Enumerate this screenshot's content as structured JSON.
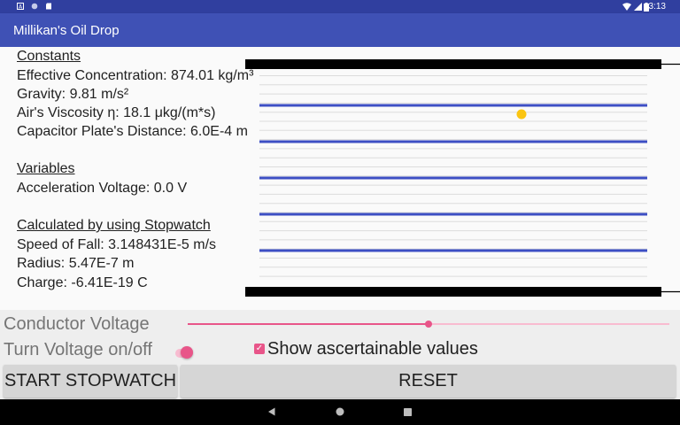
{
  "status_bar": {
    "time": "3:13",
    "icons_left": [
      "a-icon",
      "circle-icon",
      "sd-icon"
    ],
    "icons_right": [
      "wifi-icon",
      "signal-icon",
      "battery-icon"
    ]
  },
  "app_bar": {
    "title": "Millikan's Oil Drop"
  },
  "constants": {
    "header": "Constants",
    "concentration": "Effective Concentration:  874.01 kg/m³",
    "gravity": "Gravity:  9.81 m/s²",
    "viscosity": "Air's Viscosity η:  18.1 μkg/(m*s)",
    "distance": "Capacitor Plate's Distance:  6.0E-4 m"
  },
  "variables": {
    "header": "Variables",
    "voltage": "Acceleration Voltage:  0.0 V"
  },
  "stopwatch_calc": {
    "header": "Calculated by using Stopwatch",
    "speed": "Speed of Fall:  3.148431E-5 m/s",
    "radius": "Radius:  5.47E-7 m",
    "charge": "Charge:  -6.41E-19 C"
  },
  "simulation": {
    "plate_color": "#000000",
    "marker_line_color": "#3d4fc4",
    "grid_line_color": "#dcdcdc",
    "drop_color": "#fbc512"
  },
  "controls": {
    "conductor_label": "Conductor Voltage",
    "conductor_value": 0.5,
    "toggle_label": "Turn Voltage on/off",
    "toggle_on": true,
    "checkbox_label": "Show ascertainable values",
    "checkbox_checked": true,
    "stopwatch_button": "START STOPWATCH",
    "reset_button": "RESET",
    "accent_color": "#e85589"
  },
  "nav_bar": {
    "icons": [
      "back-icon",
      "home-icon",
      "recents-icon"
    ]
  }
}
